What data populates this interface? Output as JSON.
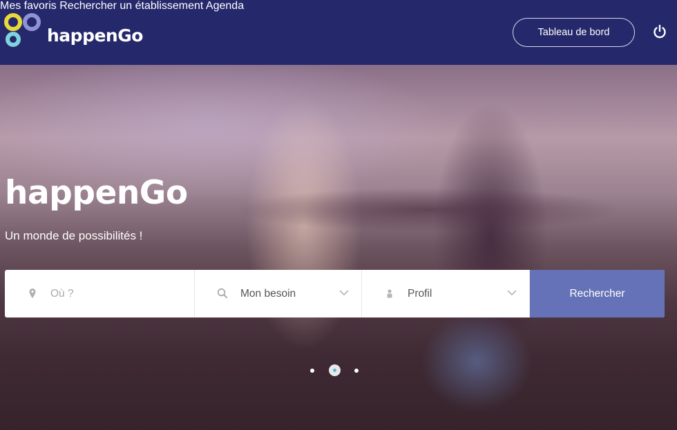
{
  "header": {
    "brand": "happenGo",
    "nav": [
      {
        "label": "Mes favoris"
      },
      {
        "label": "Rechercher un établissement"
      },
      {
        "label": "Agenda"
      }
    ],
    "dashboard_button": "Tableau de bord",
    "logout_icon": "power-icon"
  },
  "hero": {
    "title": "happenGo",
    "subtitle": "Un monde de possibilités !",
    "search": {
      "location_placeholder": "Où ?",
      "need_select": "Mon besoin",
      "profile_select": "Profil",
      "submit": "Rechercher"
    },
    "carousel": {
      "slides": 3,
      "active": 2
    }
  },
  "colors": {
    "header_bg": "#25286b",
    "button": "#6672b7",
    "logo_yellow": "#e8d93a",
    "logo_cyan": "#7fd3df",
    "logo_purple": "#8f93d6"
  }
}
